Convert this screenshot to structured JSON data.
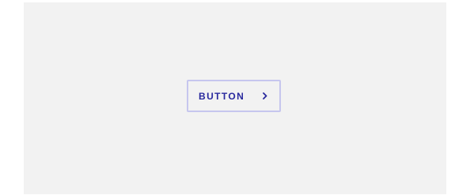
{
  "button": {
    "label": "BUTTON",
    "icon": "chevron-right-icon",
    "text_color": "#2a2a9e",
    "border_color": "#c6c6ee"
  },
  "background_color": "#f2f2f2"
}
